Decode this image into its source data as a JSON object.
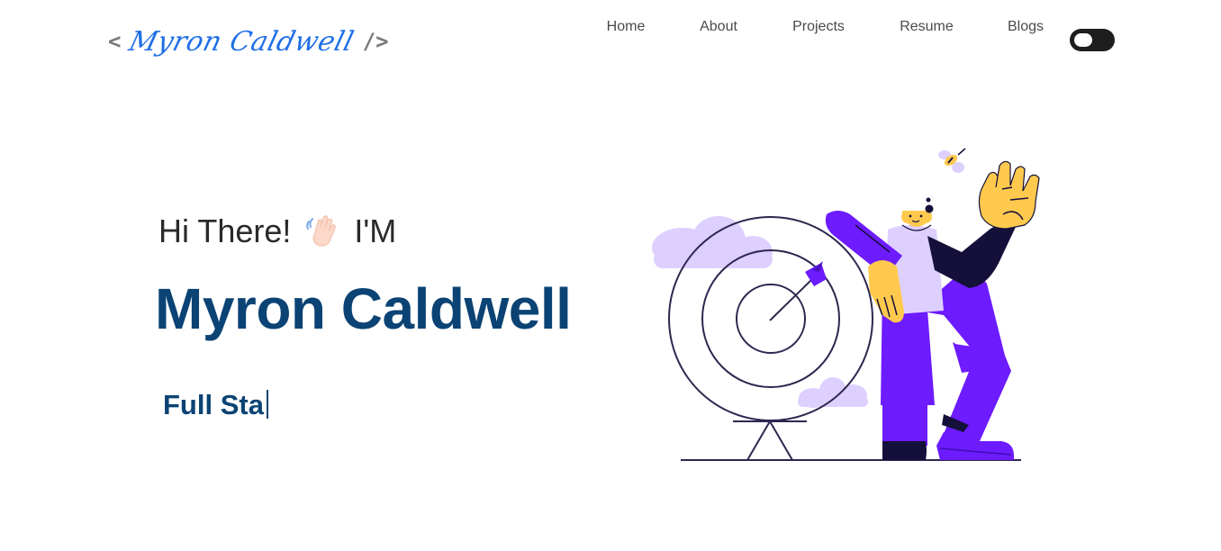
{
  "navbar": {
    "logo": {
      "open_bracket": "<",
      "signature": "Myron Caldwell",
      "close_bracket": "/>"
    },
    "links": [
      {
        "label": "Home"
      },
      {
        "label": "About"
      },
      {
        "label": "Projects"
      },
      {
        "label": "Resume"
      },
      {
        "label": "Blogs"
      }
    ],
    "theme_toggle": {
      "state": "dark"
    }
  },
  "hero": {
    "greeting_start": "Hi There!",
    "greeting_end": "I'M",
    "wave_icon": "waving-hand-icon",
    "name": "Myron Caldwell",
    "typed_text": "Full Sta",
    "illustration": "person-with-dartboard-illustration"
  },
  "colors": {
    "accent_blue": "#1f6fe5",
    "name_navy": "#0b4374",
    "purple": "#6d1bff",
    "lavender": "#ddd0ff",
    "yellow": "#ffc94d",
    "dark_navy": "#15103a"
  }
}
